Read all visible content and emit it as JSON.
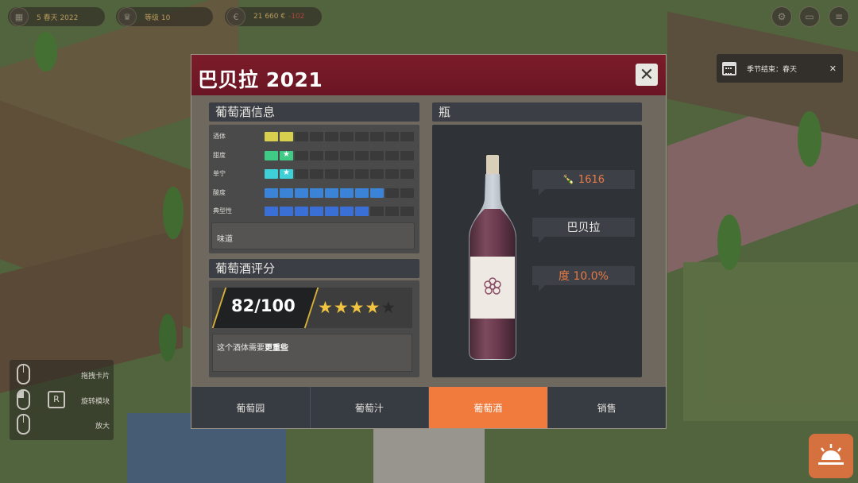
{
  "hud": {
    "date": "5 春天 2022",
    "level": "等级 10",
    "money": "21 660 €",
    "money_delta": "-102"
  },
  "toast": {
    "text": "季节结束：春天",
    "close": "✕"
  },
  "controls_help": [
    {
      "label": "拖拽卡片"
    },
    {
      "key": "R",
      "label": "旋转模块"
    },
    {
      "label": "放大"
    }
  ],
  "modal": {
    "title": "巴贝拉 2021",
    "close": "✕",
    "wine_info": {
      "header": "葡萄酒信息",
      "attributes": [
        {
          "name": "酒体",
          "filled": 2,
          "color": "#d9cf4e",
          "stars": 0
        },
        {
          "name": "甜度",
          "filled": 2,
          "color": "#3fcb86",
          "stars": 1
        },
        {
          "name": "单宁",
          "filled": 2,
          "color": "#3fcfd6",
          "stars": 1
        },
        {
          "name": "酸度",
          "filled": 8,
          "color": "#3a83d6",
          "stars": 0
        },
        {
          "name": "典型性",
          "filled": 7,
          "color": "#3a6fd6",
          "stars": 0
        }
      ],
      "segments_total": 10,
      "taste_label": "味道"
    },
    "rating": {
      "header": "葡萄酒评分",
      "score": "82/100",
      "stars_on": 4,
      "stars_total": 5,
      "comment_prefix": "这个酒体需要",
      "comment_bold": "更重些"
    },
    "bottle": {
      "header": "瓶",
      "count": "1616",
      "variety": "巴贝拉",
      "alcohol": "度 10.0%"
    },
    "tabs": [
      "葡萄园",
      "葡萄汁",
      "葡萄酒",
      "销售"
    ],
    "active_tab": 2
  }
}
